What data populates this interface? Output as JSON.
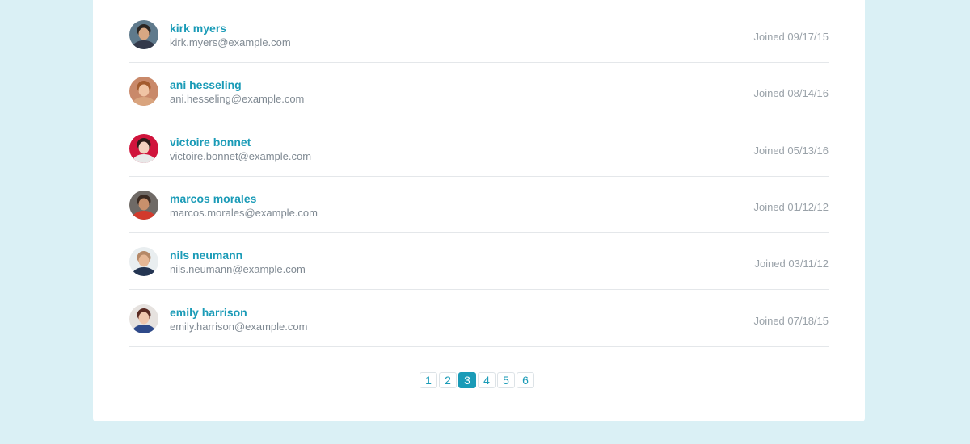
{
  "users": [
    {
      "name": "kirk myers",
      "email": "kirk.myers@example.com",
      "joined": "Joined 09/17/15",
      "avatar": {
        "bg": "#5f7a8c",
        "skin": "#d8a783",
        "hair": "#2a2522",
        "shirt": "#33394a"
      }
    },
    {
      "name": "ani hesseling",
      "email": "ani.hesseling@example.com",
      "joined": "Joined 08/14/16",
      "avatar": {
        "bg": "#c9896a",
        "skin": "#f0c4a4",
        "hair": "#a35b2e",
        "shirt": "#d9a47e"
      }
    },
    {
      "name": "victoire bonnet",
      "email": "victoire.bonnet@example.com",
      "joined": "Joined 05/13/16",
      "avatar": {
        "bg": "#d0143c",
        "skin": "#f2d2c0",
        "hair": "#2b1d1a",
        "shirt": "#e8e8e8"
      }
    },
    {
      "name": "marcos morales",
      "email": "marcos.morales@example.com",
      "joined": "Joined 01/12/12",
      "avatar": {
        "bg": "#6f6a66",
        "skin": "#c8906c",
        "hair": "#3a2a22",
        "shirt": "#d23a2c"
      }
    },
    {
      "name": "nils neumann",
      "email": "nils.neumann@example.com",
      "joined": "Joined 03/11/12",
      "avatar": {
        "bg": "#e9eef0",
        "skin": "#e6b795",
        "hair": "#b58867",
        "shirt": "#243552"
      }
    },
    {
      "name": "emily harrison",
      "email": "emily.harrison@example.com",
      "joined": "Joined 07/18/15",
      "avatar": {
        "bg": "#e6e2df",
        "skin": "#efc6ad",
        "hair": "#5a2a22",
        "shirt": "#2f4a8a"
      }
    }
  ],
  "pagination": {
    "pages": [
      "1",
      "2",
      "3",
      "4",
      "5",
      "6"
    ],
    "active": "3"
  },
  "colors": {
    "accent": "#1a9bb7",
    "page_bg": "#daf0f5"
  }
}
